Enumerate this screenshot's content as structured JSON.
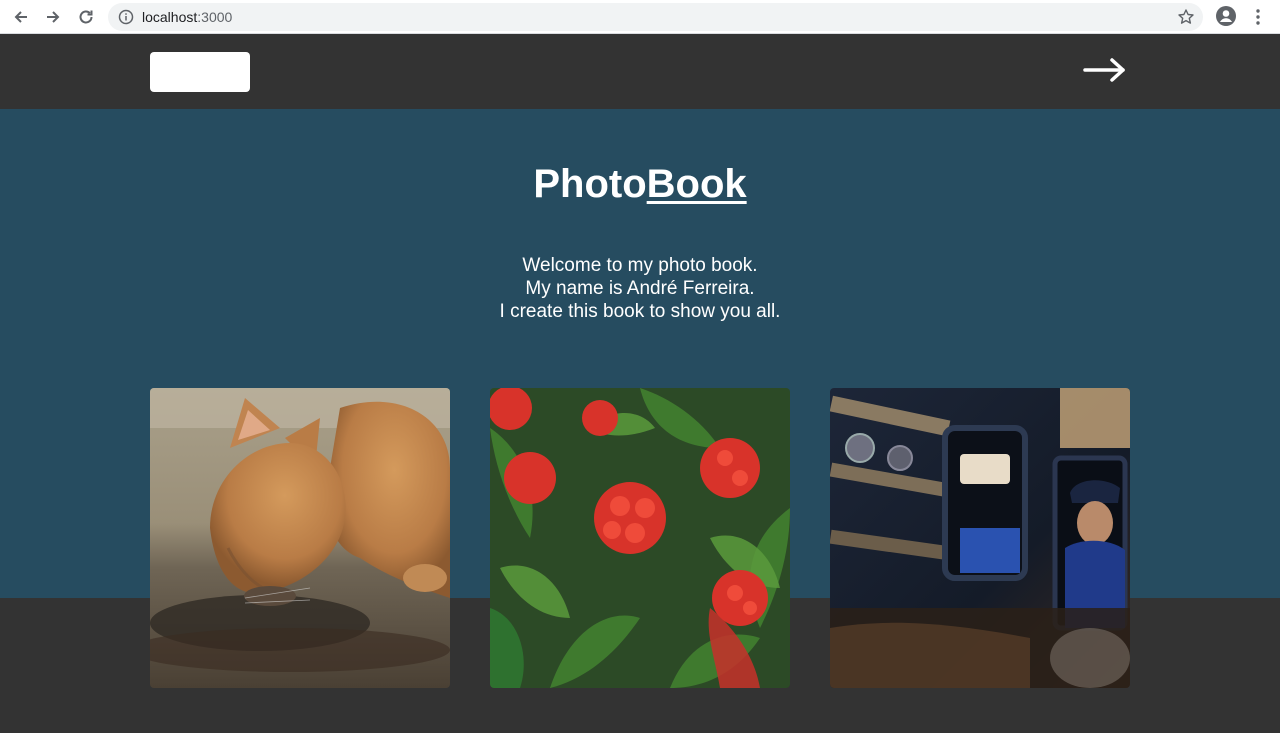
{
  "browser": {
    "url_host": "localhost",
    "url_port": ":3000",
    "icons": [
      "back-icon",
      "forward-icon",
      "reload-icon",
      "info-icon",
      "star-icon",
      "profile-icon",
      "kebab-menu-icon"
    ]
  },
  "header": {
    "next_icon": "arrow-right-icon"
  },
  "hero": {
    "title_part1": "Photo",
    "title_part2": "Book",
    "welcome_lines": [
      "Welcome to my photo book.",
      "My name is André Ferreira.",
      "I create this book to show you all."
    ]
  },
  "colors": {
    "header_bg": "#333333",
    "hero_bg": "#264c60",
    "text": "#ffffff"
  }
}
